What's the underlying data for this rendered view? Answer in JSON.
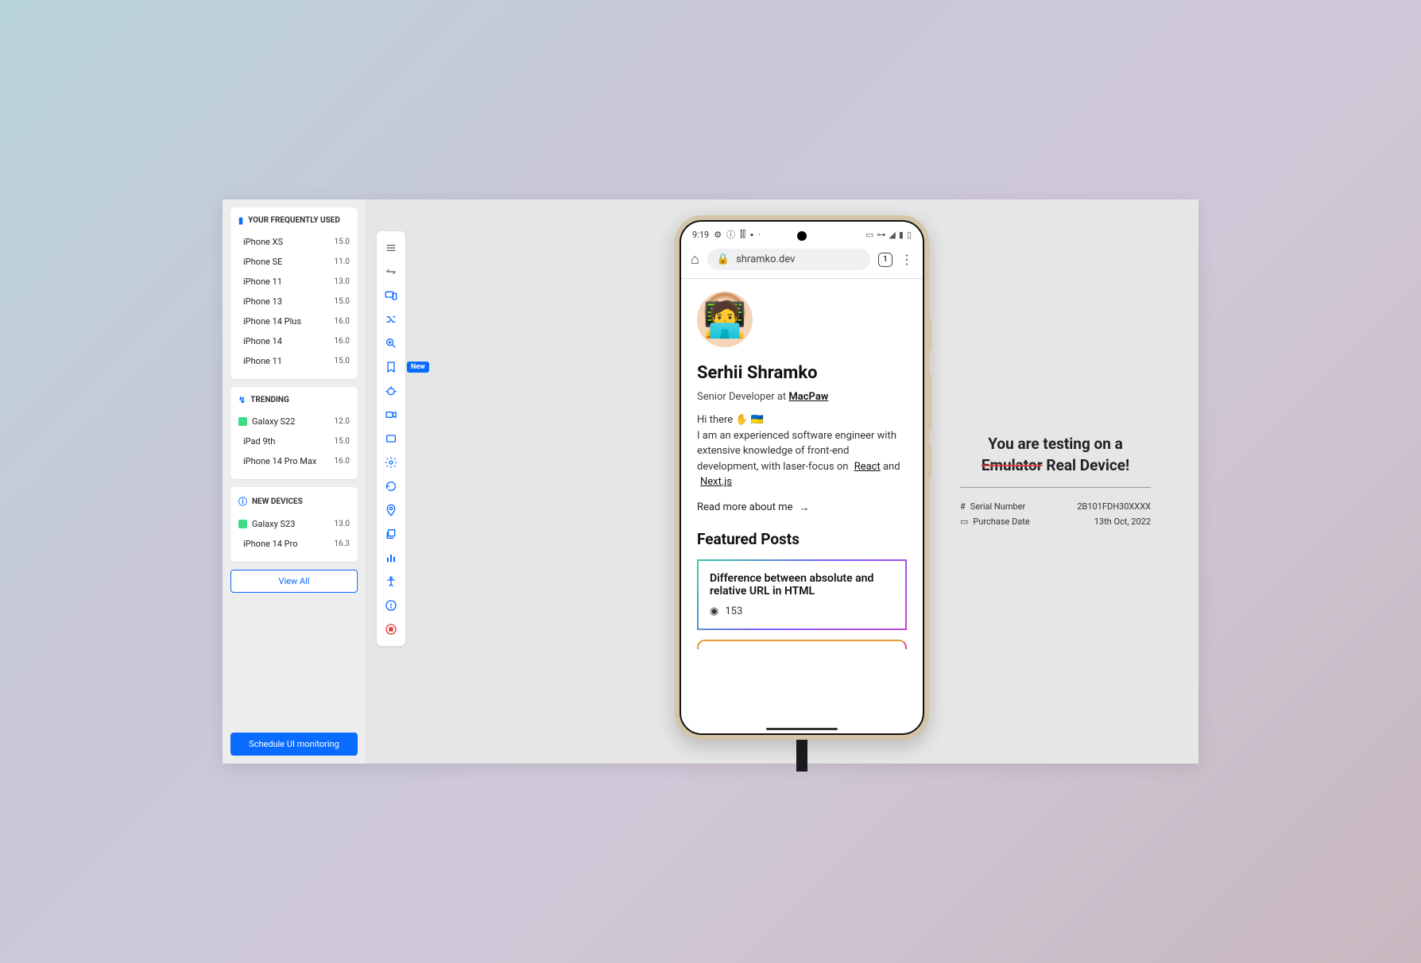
{
  "sidebar": {
    "sections": [
      {
        "header": "YOUR FREQUENTLY USED",
        "icon": "bookmark-icon",
        "items": [
          {
            "name": "iPhone XS",
            "ver": "15.0",
            "os": "apple"
          },
          {
            "name": "iPhone SE",
            "ver": "11.0",
            "os": "apple"
          },
          {
            "name": "iPhone 11",
            "ver": "13.0",
            "os": "apple"
          },
          {
            "name": "iPhone 13",
            "ver": "15.0",
            "os": "apple"
          },
          {
            "name": "iPhone 14 Plus",
            "ver": "16.0",
            "os": "apple"
          },
          {
            "name": "iPhone 14",
            "ver": "16.0",
            "os": "apple"
          },
          {
            "name": "iPhone 11",
            "ver": "15.0",
            "os": "apple"
          }
        ]
      },
      {
        "header": "TRENDING",
        "icon": "bolt-icon",
        "items": [
          {
            "name": "Galaxy S22",
            "ver": "12.0",
            "os": "android"
          },
          {
            "name": "iPad 9th",
            "ver": "15.0",
            "os": "apple"
          },
          {
            "name": "iPhone 14 Pro Max",
            "ver": "16.0",
            "os": "apple"
          }
        ]
      },
      {
        "header": "NEW DEVICES",
        "icon": "info-icon",
        "items": [
          {
            "name": "Galaxy S23",
            "ver": "13.0",
            "os": "android"
          },
          {
            "name": "iPhone 14 Pro",
            "ver": "16.3",
            "os": "apple"
          }
        ]
      }
    ],
    "view_all": "View All",
    "schedule": "Schedule UI monitoring"
  },
  "toolbar": {
    "new_badge": "New"
  },
  "phone": {
    "time": "9:19",
    "url": "shramko.dev",
    "tabs": "1",
    "heading": "Serhii Shramko",
    "role_prefix": "Senior Developer at ",
    "role_company": "MacPaw",
    "intro_line1": "Hi there ✋ 🇺🇦",
    "intro_line2": "I am an experienced software engineer with extensive knowledge of front-end development, with laser-focus on",
    "tech1": "React",
    "intro_and": "and",
    "tech2": "Next.js",
    "read_more": "Read more about me",
    "posts_heading": "Featured Posts",
    "post1_title": "Difference between absolute and relative URL in HTML",
    "post1_views": "153"
  },
  "info": {
    "line1": "You are testing on a",
    "strike": "Emulator",
    "line2": " Real Device!",
    "serial_lbl": "Serial Number",
    "serial_val": "2B101FDH30XXXX",
    "date_lbl": "Purchase Date",
    "date_val": "13th Oct, 2022"
  }
}
